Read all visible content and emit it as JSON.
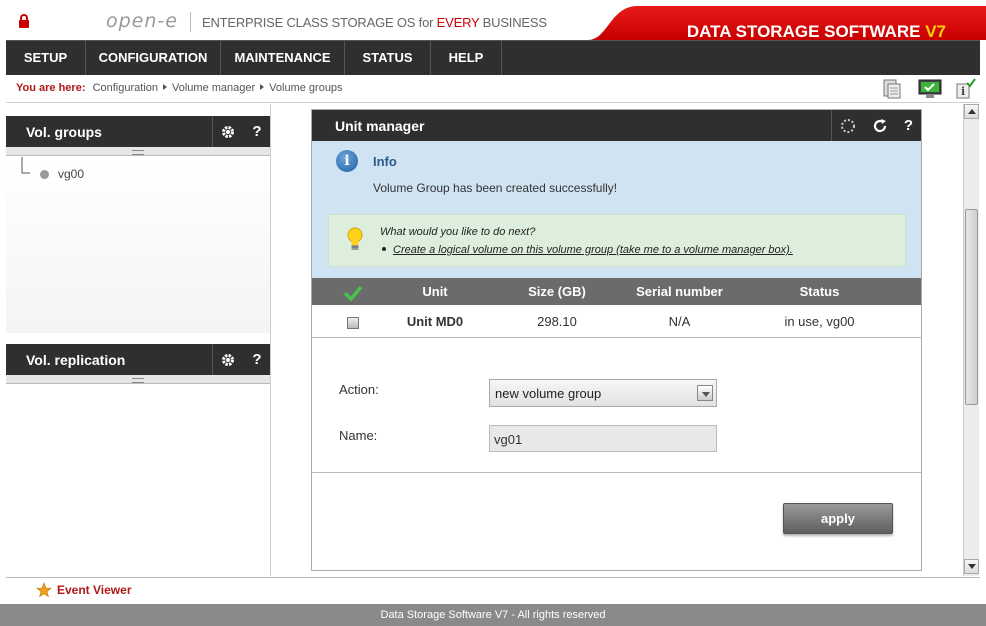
{
  "header": {
    "logo_text": "open-e",
    "tagline_prefix": "ENTERPRISE CLASS STORAGE OS for ",
    "tagline_highlight": "EVERY",
    "tagline_suffix": " BUSINESS",
    "brand_name": "DATA STORAGE SOFTWARE ",
    "brand_version": "V7"
  },
  "nav": {
    "items": [
      "SETUP",
      "CONFIGURATION",
      "MAINTENANCE",
      "STATUS",
      "HELP"
    ]
  },
  "breadcrumb": {
    "prefix": "You are here:",
    "items": [
      "Configuration",
      "Volume manager",
      "Volume groups"
    ]
  },
  "sidebar": {
    "vol_groups": {
      "title": "Vol. groups",
      "items": [
        "vg00"
      ]
    },
    "vol_replication": {
      "title": "Vol. replication"
    }
  },
  "unit_manager": {
    "title": "Unit manager",
    "info": {
      "title": "Info",
      "message": "Volume Group has been created successfully!",
      "next_question": "What would you like to do next?",
      "next_link": "Create a logical volume on this volume group (take me to a volume manager box)."
    },
    "table": {
      "headers": [
        "Unit",
        "Size (GB)",
        "Serial number",
        "Status"
      ],
      "rows": [
        {
          "unit": "Unit MD0",
          "size": "298.10",
          "serial": "N/A",
          "status": "in use, vg00"
        }
      ]
    },
    "form": {
      "action_label": "Action:",
      "action_value": "new volume group",
      "name_label": "Name:",
      "name_value": "vg01"
    },
    "apply_label": "apply"
  },
  "event_viewer": {
    "label": "Event Viewer"
  },
  "footer": {
    "text": "Data Storage Software V7 - All rights reserved"
  },
  "colors": {
    "brand_red": "#d40000",
    "dark_bar": "#2f2f2f",
    "info_bg": "#cfe3f2",
    "next_bg": "#ddeedd",
    "highlight_red": "#b01818",
    "version_yellow": "#ffd200"
  }
}
